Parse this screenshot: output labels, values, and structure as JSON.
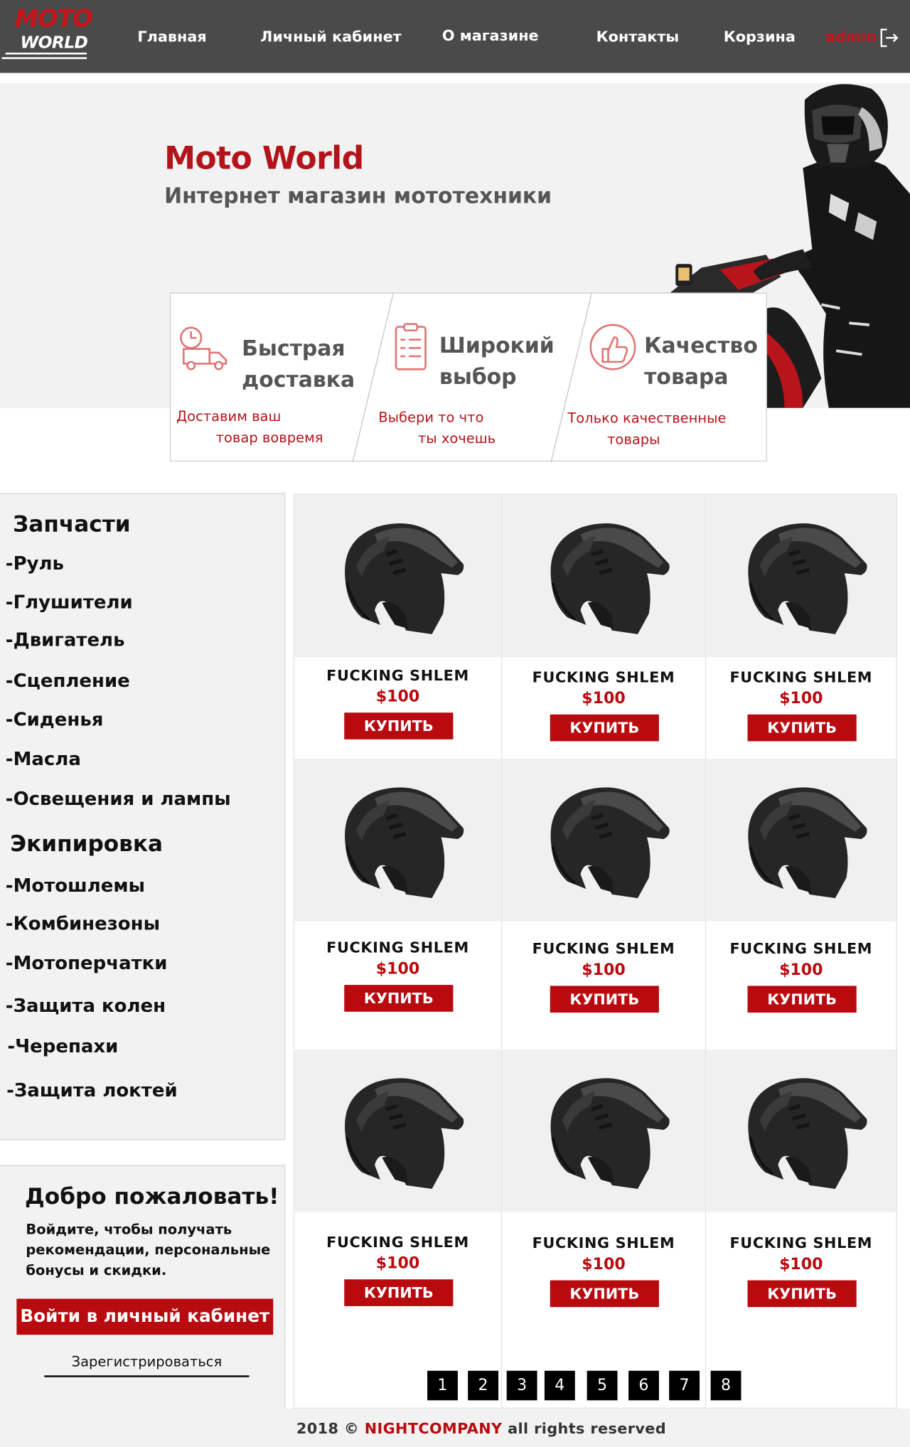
{
  "header": {
    "logo_top": "MOTO",
    "logo_bottom": "WORLD",
    "nav": [
      "Главная",
      "Личный кабинет",
      "О магазине",
      "Контакты",
      "Корзина"
    ],
    "user": "admin"
  },
  "hero": {
    "title": "Moto World",
    "subtitle": "Интернет магазин мототехники",
    "features": [
      {
        "icon": "delivery-truck-icon",
        "title": "Быстрая\nдоставка",
        "desc": "Доставим ваш\n         товар вовремя"
      },
      {
        "icon": "checklist-icon",
        "title": "Широкий\nвыбор",
        "desc": "Выбери то что\n         ты хочешь"
      },
      {
        "icon": "thumbs-up-icon",
        "title": "Качество\nтовара",
        "desc": "Только качественные\n         товары"
      }
    ]
  },
  "sidebar": {
    "groups": [
      {
        "heading": "Запчасти",
        "items": [
          "-Руль",
          "-Глушители",
          "-Двигатель",
          "-Сцепление",
          "-Сиденья",
          "-Масла",
          "-Освещения и лампы"
        ]
      },
      {
        "heading": "Экипировка",
        "items": [
          "-Мотошлемы",
          "-Комбинезоны",
          "-Мотоперчатки",
          "-Защита колен",
          "-Черепахи",
          "-Защита локтей"
        ]
      }
    ]
  },
  "welcome": {
    "title": "Добро пожаловать!",
    "text": "Войдите, чтобы получать рекомендации, персональные бонусы и скидки.",
    "login_button": "Войти в личный кабинет",
    "register_link": "Зарегистрироваться"
  },
  "products": [
    {
      "name": "FUCKING SHLEM",
      "price": "$100",
      "button": "КУПИТЬ"
    },
    {
      "name": "FUCKING SHLEM",
      "price": "$100",
      "button": "КУПИТЬ"
    },
    {
      "name": "FUCKING SHLEM",
      "price": "$100",
      "button": "КУПИТЬ"
    },
    {
      "name": "FUCKING SHLEM",
      "price": "$100",
      "button": "КУПИТЬ"
    },
    {
      "name": "FUCKING SHLEM",
      "price": "$100",
      "button": "КУПИТЬ"
    },
    {
      "name": "FUCKING SHLEM",
      "price": "$100",
      "button": "КУПИТЬ"
    },
    {
      "name": "FUCKING SHLEM",
      "price": "$100",
      "button": "КУПИТЬ"
    },
    {
      "name": "FUCKING SHLEM",
      "price": "$100",
      "button": "КУПИТЬ"
    },
    {
      "name": "FUCKING SHLEM",
      "price": "$100",
      "button": "КУПИТЬ"
    }
  ],
  "pagination": [
    "1",
    "2",
    "3",
    "4",
    "5",
    "6",
    "7",
    "8"
  ],
  "footer": {
    "prefix": "2018 ©",
    "company": "NIGHTCOMPANY",
    "suffix": "all rights reserved"
  },
  "colors": {
    "accent": "#b80a0f",
    "header_bg": "#4a4a4a",
    "panel_bg": "#f2f2f2"
  }
}
